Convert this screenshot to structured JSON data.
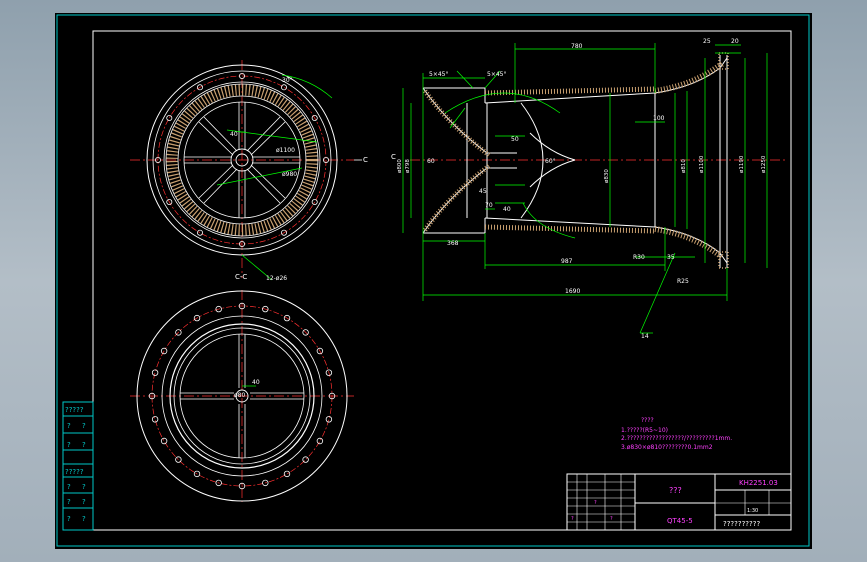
{
  "colors": {
    "background": "#000000",
    "frame": "#00c8c8",
    "outline": "#ffffff",
    "dimension": "#00ff00",
    "centerline": "#ff3030",
    "hatch": "#c9a070",
    "text": "#ff40ff",
    "bolt": "#ff4040"
  },
  "title_block": {
    "drawing_number": "KH2251.03",
    "part_name": "???",
    "material": "QT45-5",
    "company": "??????????",
    "scale": "1:30",
    "cells": [
      "?",
      "?",
      "?"
    ]
  },
  "side_labels": [
    "?????",
    "?",
    "?",
    "?",
    "?",
    "?????",
    "?",
    "?",
    "?",
    "?",
    "?",
    "?",
    "?"
  ],
  "notes": {
    "title": "????",
    "lines": [
      "1.?????(R5~10)",
      "2.??????????????????/?????????1mm.",
      "3.ø830×ø810????????0.1mm2"
    ]
  },
  "top_view": {
    "angle_label": "30°",
    "inner_dia": "ø1100",
    "bolt_circle": "ø980",
    "hole_spec": "12-ø26",
    "rib_width": "40",
    "section_mark": "C"
  },
  "bottom_view": {
    "section_label": "C-C",
    "rib_width": "40",
    "hub_dia": "ø80"
  },
  "section_view": {
    "dim_overall": "1690",
    "dim_top": "780",
    "dim_left": "368",
    "dim_mid": "987",
    "chamfer1": "5×45°",
    "chamfer2": "5×45°",
    "d_left": "ø800",
    "d_left2": "ø798",
    "d_mid1": "ø830",
    "d_mid2": "ø810",
    "d_right1": "ø1100",
    "d_right2": "ø1190",
    "d_right3": "ø1250",
    "angle": "60°",
    "r_label": "R30",
    "dim_100": "100",
    "dim_50": "50",
    "dim_45": "45",
    "dim_70": "70",
    "dim_40": "40",
    "dim_60": "60",
    "dim_35": "35",
    "dim_14": "14",
    "dim_25": "25",
    "dim_20": "20",
    "r_small": "R25",
    "section_mark": "C"
  }
}
